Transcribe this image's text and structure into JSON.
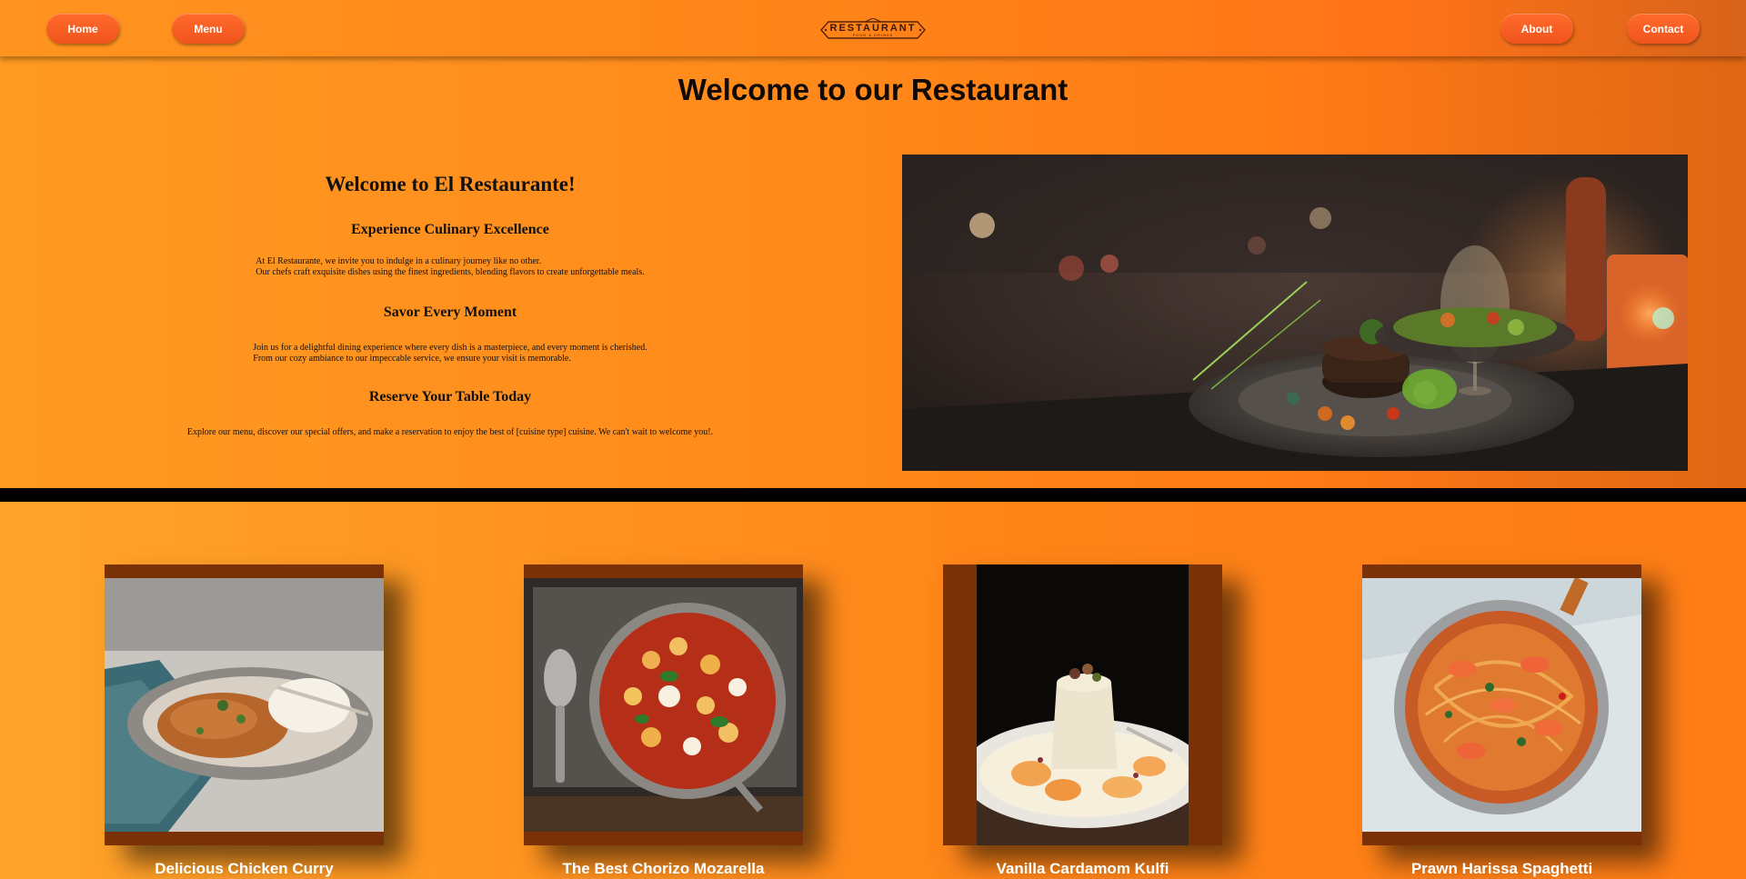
{
  "nav": {
    "home": "Home",
    "menu": "Menu",
    "about": "About",
    "contact": "Contact",
    "logo": {
      "title": "RESTAURANT",
      "subtitle": "FOOD & DRINKS"
    }
  },
  "hero": {
    "page_title": "Welcome to our Restaurant",
    "heading": "Welcome to El Restaurante!",
    "sections": [
      {
        "title": "Experience Culinary Excellence",
        "lines": [
          "At El Restaurante, we invite you to indulge in a culinary journey like no other.",
          "Our chefs craft exquisite dishes using the finest ingredients, blending flavors to create unforgettable meals."
        ]
      },
      {
        "title": "Savor Every Moment",
        "lines": [
          "Join us for a delightful dining experience where every dish is a masterpiece, and every moment is cherished.",
          "From our cozy ambiance to our impeccable service, we ensure your visit is memorable."
        ]
      },
      {
        "title": "Reserve Your Table Today",
        "lines": [
          "Explore our menu, discover our special offers, and make a reservation to enjoy the best of [cuisine type] cuisine. We can't wait to welcome you!."
        ]
      }
    ]
  },
  "dishes": [
    {
      "name": "Delicious Chicken Curry"
    },
    {
      "name": "The Best Chorizo Mozarella"
    },
    {
      "name": "Vanilla Cardamom Kulfi"
    },
    {
      "name": "Prawn Harissa Spaghetti"
    }
  ]
}
